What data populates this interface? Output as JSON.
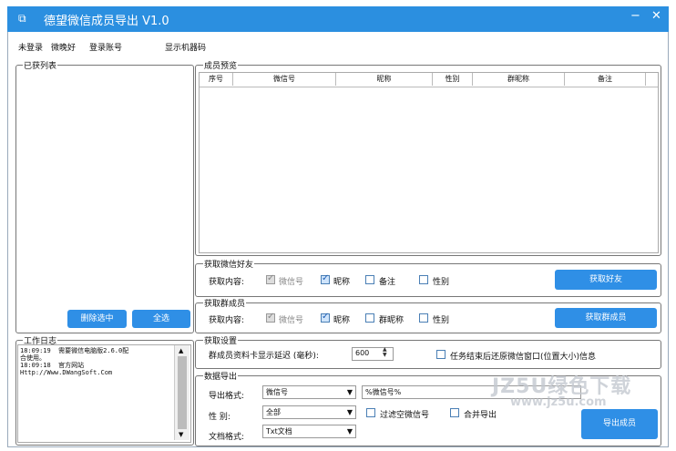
{
  "window": {
    "title": "德望微信成员导出 V1.0",
    "minimize_glyph": "−",
    "close_glyph": "✕",
    "icon": "app-icon"
  },
  "status": {
    "login_state": "未登录",
    "nickname": "微晚好",
    "login_label": "登录账号",
    "machine_code": "显示机器码"
  },
  "left": {
    "fetched_list_legend": "已获列表",
    "delete_selected": "删除选中",
    "select_all": "全选",
    "worklog_legend": "工作日志",
    "log_lines": [
      "18:09:19  需要微信电脑版2.6.0配",
      "合使用。",
      "18:09:18  官方网站",
      "Http://Www.DWangSoft.Com"
    ]
  },
  "members_preview": {
    "legend": "成员预览",
    "columns": [
      "序号",
      "微信号",
      "昵称",
      "性别",
      "群昵称",
      "备注"
    ]
  },
  "friends": {
    "legend": "获取微信好友",
    "content_label": "获取内容:",
    "options": [
      {
        "label": "微信号",
        "state": "checked-disabled"
      },
      {
        "label": "昵称",
        "state": "checked"
      },
      {
        "label": "备注",
        "state": "unchecked"
      },
      {
        "label": "性别",
        "state": "unchecked"
      }
    ],
    "button": "获取好友"
  },
  "groups": {
    "legend": "获取群成员",
    "content_label": "获取内容:",
    "options": [
      {
        "label": "微信号",
        "state": "checked-disabled"
      },
      {
        "label": "昵称",
        "state": "checked"
      },
      {
        "label": "群昵称",
        "state": "unchecked"
      },
      {
        "label": "性别",
        "state": "unchecked"
      }
    ],
    "button": "获取群成员"
  },
  "settings": {
    "legend": "获取设置",
    "delay_label": "群成员资料卡显示延迟 (毫秒):",
    "delay_value": "600",
    "restore_label": "任务结束后还原微信窗口(位置大小)信息"
  },
  "export": {
    "legend": "数据导出",
    "format_label": "导出格式:",
    "format_value": "微信号",
    "format_template": "%微信号%",
    "gender_label": "性  别:",
    "gender_value": "全部",
    "filter_empty_label": "过滤空微信号",
    "merge_label": "合并导出",
    "doc_label": "文档格式:",
    "doc_value": "Txt文档",
    "button": "导出成员"
  },
  "watermark": {
    "line1": "JZ5U绿色下载",
    "line2": "www.jz5u.com"
  }
}
